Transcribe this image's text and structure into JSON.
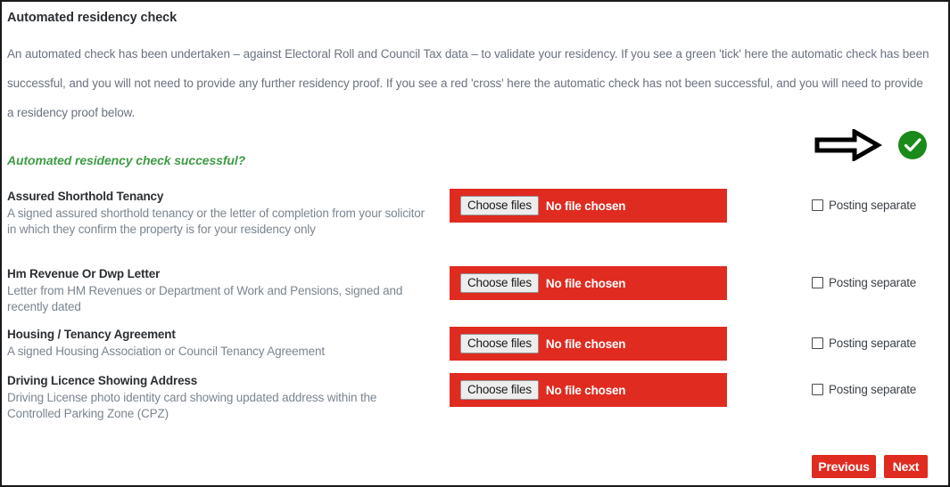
{
  "section": {
    "title": "Automated residency check",
    "intro": "An automated check has been undertaken – against Electoral Roll and Council Tax data – to validate your residency. If you see a green 'tick' here the automatic check has been successful, and you will not need to provide any further residency proof. If you see a red 'cross' here the automatic check has not been successful, and you will need to provide a residency proof below."
  },
  "status": {
    "question": "Automated residency check successful?",
    "result_icon": "green-tick-icon",
    "pointer_icon": "right-arrow-icon",
    "tick_color": "#1a8a1a",
    "question_color": "#3f9b46"
  },
  "file_field_defaults": {
    "button_label": "Choose files",
    "no_file_text": "No file chosen",
    "background_color": "#e02b20"
  },
  "checkbox_defaults": {
    "label": "Posting separate",
    "checked": false
  },
  "documents": [
    {
      "name": "Assured Shorthold Tenancy",
      "description": "A signed assured shorthold tenancy or the letter of completion from your solicitor in which they confirm the property is for your residency only",
      "file": {
        "button_label": "Choose files",
        "no_file_text": "No file chosen"
      },
      "checkbox": {
        "label": "Posting separate",
        "checked": false
      }
    },
    {
      "name": "Hm Revenue Or Dwp Letter",
      "description": "Letter from HM Revenues or Department of Work and Pensions, signed and recently dated",
      "file": {
        "button_label": "Choose files",
        "no_file_text": "No file chosen"
      },
      "checkbox": {
        "label": "Posting separate",
        "checked": false
      }
    },
    {
      "name": "Housing / Tenancy Agreement",
      "description": "A signed Housing Association or Council Tenancy Agreement",
      "file": {
        "button_label": "Choose files",
        "no_file_text": "No file chosen"
      },
      "checkbox": {
        "label": "Posting separate",
        "checked": false
      }
    },
    {
      "name": "Driving Licence Showing Address",
      "description": "Driving License photo identity card showing updated address within the Controlled Parking Zone (CPZ)",
      "file": {
        "button_label": "Choose files",
        "no_file_text": "No file chosen"
      },
      "checkbox": {
        "label": "Posting separate",
        "checked": false
      }
    }
  ],
  "footer": {
    "previous_label": "Previous",
    "next_label": "Next",
    "button_color": "#e02b20"
  }
}
